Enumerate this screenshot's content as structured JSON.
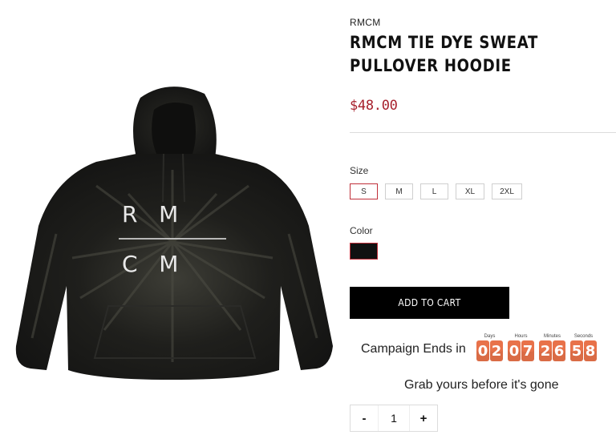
{
  "product": {
    "vendor": "RMCM",
    "title": "RMCM TIE DYE SWEAT PULLOVER HOODIE",
    "price": "$48.00",
    "image": {
      "description": "black tie-dye hoodie",
      "print_top": "R   M",
      "print_bottom": "C   M"
    }
  },
  "options": {
    "size_label": "Size",
    "sizes": [
      "S",
      "M",
      "L",
      "XL",
      "2XL"
    ],
    "selected_size": "S",
    "color_label": "Color",
    "selected_color": "#111111"
  },
  "cart": {
    "add_label": "ADD TO CART"
  },
  "campaign": {
    "label": "Campaign Ends in",
    "units": [
      {
        "label": "Days",
        "value": "02"
      },
      {
        "label": "Hours",
        "value": "07"
      },
      {
        "label": "Minutes",
        "value": "26"
      },
      {
        "label": "Seconds",
        "value": "58"
      }
    ],
    "tagline": "Grab yours before it's gone"
  },
  "quantity": {
    "minus": "-",
    "value": "1",
    "plus": "+"
  },
  "colors": {
    "price": "#a7212d",
    "accent": "#c0303a",
    "timer": "#e8724a"
  }
}
